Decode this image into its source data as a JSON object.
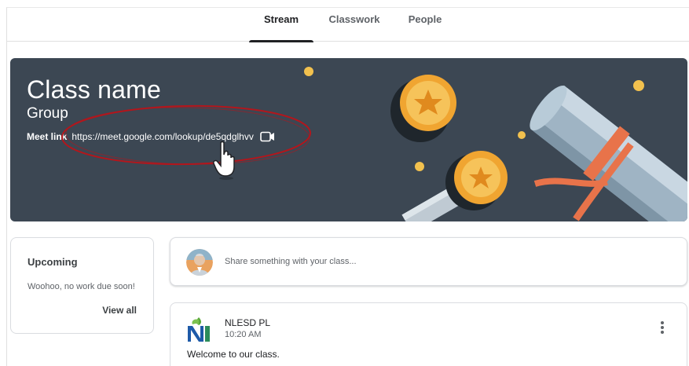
{
  "nav": {
    "tabs": [
      {
        "label": "Stream",
        "active": true
      },
      {
        "label": "Classwork",
        "active": false
      },
      {
        "label": "People",
        "active": false
      }
    ]
  },
  "banner": {
    "class_name": "Class name",
    "section": "Group",
    "meet_label": "Meet link",
    "meet_url": "https://meet.google.com/lookup/de5qdglhvv",
    "video_icon": "video-camera-icon",
    "background_color": "#3c4753"
  },
  "annotation": {
    "highlight_color": "#b3161c",
    "cursor_icon": "hand-pointer-icon"
  },
  "upcoming": {
    "title": "Upcoming",
    "empty_text": "Woohoo, no work due soon!",
    "view_all": "View all"
  },
  "share": {
    "placeholder": "Share something with your class..."
  },
  "post": {
    "author": "NLESD PL",
    "time": "10:20 AM",
    "body": "Welcome to our class.",
    "menu_icon": "more-vertical-icon"
  }
}
